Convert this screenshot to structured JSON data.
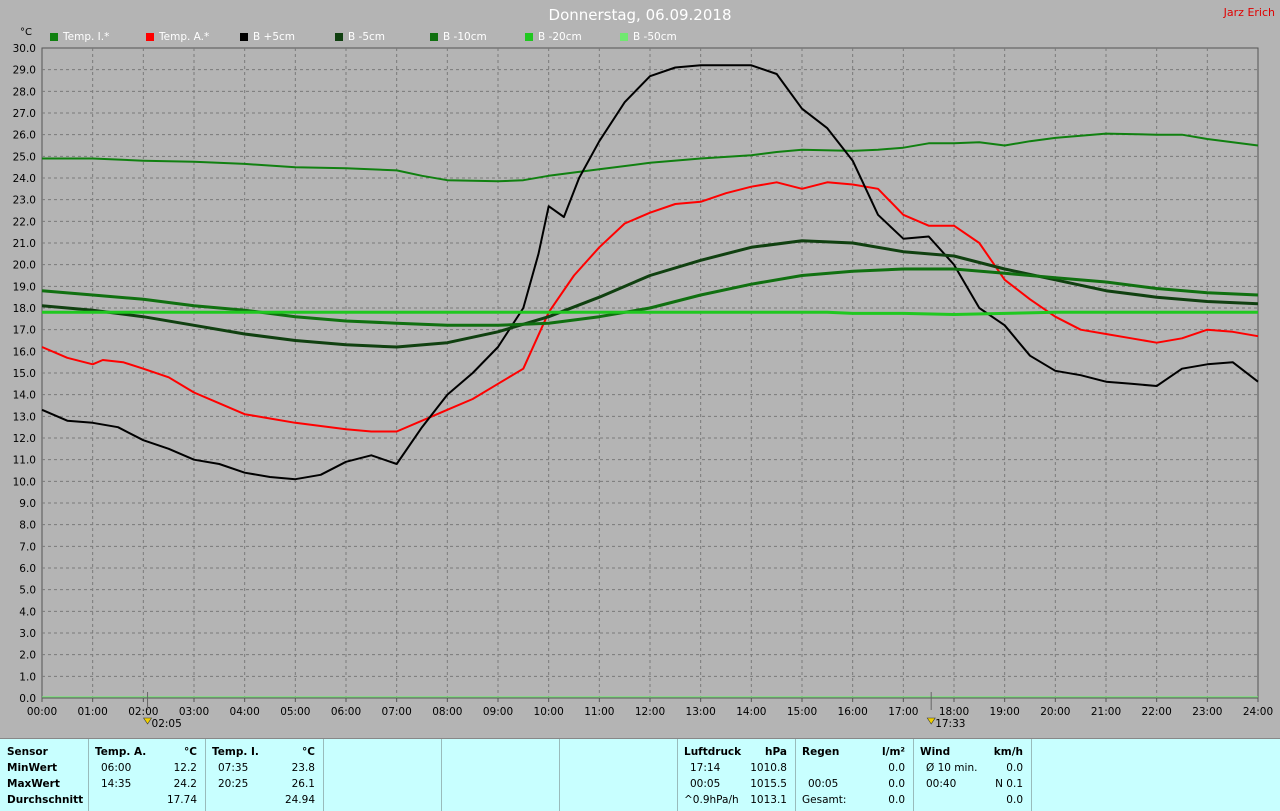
{
  "title": "Donnerstag, 06.09.2018",
  "author": "Jarz Erich",
  "unit": "°C",
  "colors": {
    "background": "#b4b4b4",
    "stats_bg": "#c8ffff",
    "temp_i": "#108010",
    "temp_a": "#ff0000",
    "b_plus5": "#000000",
    "b_minus5": "#104010",
    "b_minus10": "#107010",
    "b_minus20": "#20c820",
    "b_minus50": "#70e870"
  },
  "legend": [
    "Temp. I.*",
    "Temp. A.*",
    "B +5cm",
    "B -5cm",
    "B -10cm",
    "B -20cm",
    "B -50cm"
  ],
  "markers": [
    {
      "time": 2.083,
      "label": "02:05"
    },
    {
      "time": 17.55,
      "label": "17:33"
    }
  ],
  "chart_data": {
    "type": "line",
    "xlim": [
      0,
      24
    ],
    "ylim": [
      0,
      30
    ],
    "grid": true,
    "x_ticks": [
      "00:00",
      "01:00",
      "02:00",
      "03:00",
      "04:00",
      "05:00",
      "06:00",
      "07:00",
      "08:00",
      "09:00",
      "10:00",
      "11:00",
      "12:00",
      "13:00",
      "14:00",
      "15:00",
      "16:00",
      "17:00",
      "18:00",
      "19:00",
      "20:00",
      "21:00",
      "22:00",
      "23:00",
      "24:00"
    ],
    "y_ticks": [
      "0.0",
      "1.0",
      "2.0",
      "3.0",
      "4.0",
      "5.0",
      "6.0",
      "7.0",
      "8.0",
      "9.0",
      "10.0",
      "11.0",
      "12.0",
      "13.0",
      "14.0",
      "15.0",
      "16.0",
      "17.0",
      "18.0",
      "19.0",
      "20.0",
      "21.0",
      "22.0",
      "23.0",
      "24.0",
      "25.0",
      "26.0",
      "27.0",
      "28.0",
      "29.0",
      "30.0"
    ],
    "series": [
      {
        "name": "Temp. I.*",
        "width": 2,
        "points": [
          [
            0,
            24.9
          ],
          [
            1,
            24.9
          ],
          [
            2,
            24.8
          ],
          [
            3,
            24.75
          ],
          [
            4,
            24.65
          ],
          [
            5,
            24.5
          ],
          [
            6,
            24.45
          ],
          [
            7,
            24.35
          ],
          [
            7.5,
            24.1
          ],
          [
            8,
            23.9
          ],
          [
            9,
            23.85
          ],
          [
            9.5,
            23.9
          ],
          [
            10,
            24.1
          ],
          [
            11,
            24.4
          ],
          [
            12,
            24.7
          ],
          [
            13,
            24.9
          ],
          [
            14,
            25.05
          ],
          [
            14.5,
            25.2
          ],
          [
            15,
            25.3
          ],
          [
            16,
            25.25
          ],
          [
            16.5,
            25.3
          ],
          [
            17,
            25.4
          ],
          [
            17.5,
            25.6
          ],
          [
            18,
            25.6
          ],
          [
            18.5,
            25.65
          ],
          [
            19,
            25.5
          ],
          [
            19.5,
            25.7
          ],
          [
            20,
            25.85
          ],
          [
            21,
            26.05
          ],
          [
            22,
            26.0
          ],
          [
            22.5,
            26.0
          ],
          [
            23,
            25.8
          ],
          [
            24,
            25.5
          ]
        ]
      },
      {
        "name": "Temp. A.*",
        "width": 2,
        "points": [
          [
            0,
            16.2
          ],
          [
            0.5,
            15.7
          ],
          [
            1,
            15.4
          ],
          [
            1.2,
            15.6
          ],
          [
            1.6,
            15.5
          ],
          [
            2,
            15.2
          ],
          [
            2.5,
            14.8
          ],
          [
            3,
            14.1
          ],
          [
            3.5,
            13.6
          ],
          [
            4,
            13.1
          ],
          [
            4.5,
            12.9
          ],
          [
            5,
            12.7
          ],
          [
            6,
            12.4
          ],
          [
            6.5,
            12.3
          ],
          [
            7,
            12.3
          ],
          [
            7.5,
            12.8
          ],
          [
            8,
            13.3
          ],
          [
            8.5,
            13.8
          ],
          [
            9,
            14.5
          ],
          [
            9.5,
            15.2
          ],
          [
            10,
            17.8
          ],
          [
            10.5,
            19.5
          ],
          [
            11,
            20.8
          ],
          [
            11.5,
            21.9
          ],
          [
            12,
            22.4
          ],
          [
            12.5,
            22.8
          ],
          [
            13,
            22.9
          ],
          [
            13.5,
            23.3
          ],
          [
            14,
            23.6
          ],
          [
            14.5,
            23.8
          ],
          [
            15,
            23.5
          ],
          [
            15.5,
            23.8
          ],
          [
            16,
            23.7
          ],
          [
            16.5,
            23.5
          ],
          [
            17,
            22.3
          ],
          [
            17.5,
            21.8
          ],
          [
            18,
            21.8
          ],
          [
            18.5,
            21.0
          ],
          [
            19,
            19.3
          ],
          [
            19.5,
            18.4
          ],
          [
            20,
            17.6
          ],
          [
            20.5,
            17.0
          ],
          [
            21,
            16.8
          ],
          [
            21.5,
            16.6
          ],
          [
            22,
            16.4
          ],
          [
            22.5,
            16.6
          ],
          [
            23,
            17.0
          ],
          [
            23.5,
            16.9
          ],
          [
            24,
            16.7
          ]
        ]
      },
      {
        "name": "B +5cm",
        "width": 2,
        "points": [
          [
            0,
            13.3
          ],
          [
            0.5,
            12.8
          ],
          [
            1,
            12.7
          ],
          [
            1.5,
            12.5
          ],
          [
            2,
            11.9
          ],
          [
            2.5,
            11.5
          ],
          [
            3,
            11.0
          ],
          [
            3.5,
            10.8
          ],
          [
            4,
            10.4
          ],
          [
            4.5,
            10.2
          ],
          [
            5,
            10.1
          ],
          [
            5.5,
            10.3
          ],
          [
            6,
            10.9
          ],
          [
            6.5,
            11.2
          ],
          [
            7,
            10.8
          ],
          [
            7.5,
            12.5
          ],
          [
            8,
            14.0
          ],
          [
            8.5,
            15.0
          ],
          [
            9,
            16.2
          ],
          [
            9.5,
            18.0
          ],
          [
            9.8,
            20.5
          ],
          [
            10,
            22.7
          ],
          [
            10.3,
            22.2
          ],
          [
            10.6,
            24.0
          ],
          [
            11,
            25.7
          ],
          [
            11.5,
            27.5
          ],
          [
            12,
            28.7
          ],
          [
            12.5,
            29.1
          ],
          [
            13,
            29.2
          ],
          [
            13.5,
            29.2
          ],
          [
            14,
            29.2
          ],
          [
            14.5,
            28.8
          ],
          [
            15,
            27.2
          ],
          [
            15.5,
            26.3
          ],
          [
            16,
            24.8
          ],
          [
            16.5,
            22.3
          ],
          [
            17,
            21.2
          ],
          [
            17.5,
            21.3
          ],
          [
            18,
            20.0
          ],
          [
            18.5,
            18.0
          ],
          [
            19,
            17.2
          ],
          [
            19.5,
            15.8
          ],
          [
            20,
            15.1
          ],
          [
            20.5,
            14.9
          ],
          [
            21,
            14.6
          ],
          [
            21.5,
            14.5
          ],
          [
            22,
            14.4
          ],
          [
            22.5,
            15.2
          ],
          [
            23,
            15.4
          ],
          [
            23.5,
            15.5
          ],
          [
            24,
            14.6
          ]
        ]
      },
      {
        "name": "B -5cm",
        "width": 3,
        "points": [
          [
            0,
            18.1
          ],
          [
            1,
            17.9
          ],
          [
            2,
            17.6
          ],
          [
            3,
            17.2
          ],
          [
            4,
            16.8
          ],
          [
            5,
            16.5
          ],
          [
            6,
            16.3
          ],
          [
            7,
            16.2
          ],
          [
            8,
            16.4
          ],
          [
            9,
            16.9
          ],
          [
            10,
            17.6
          ],
          [
            11,
            18.5
          ],
          [
            12,
            19.5
          ],
          [
            13,
            20.2
          ],
          [
            14,
            20.8
          ],
          [
            15,
            21.1
          ],
          [
            16,
            21.0
          ],
          [
            17,
            20.6
          ],
          [
            18,
            20.4
          ],
          [
            19,
            19.8
          ],
          [
            20,
            19.3
          ],
          [
            21,
            18.8
          ],
          [
            22,
            18.5
          ],
          [
            23,
            18.3
          ],
          [
            24,
            18.2
          ]
        ]
      },
      {
        "name": "B -10cm",
        "width": 3,
        "points": [
          [
            0,
            18.8
          ],
          [
            1,
            18.6
          ],
          [
            2,
            18.4
          ],
          [
            3,
            18.1
          ],
          [
            4,
            17.9
          ],
          [
            5,
            17.6
          ],
          [
            6,
            17.4
          ],
          [
            7,
            17.3
          ],
          [
            8,
            17.2
          ],
          [
            9,
            17.2
          ],
          [
            10,
            17.3
          ],
          [
            11,
            17.6
          ],
          [
            12,
            18.0
          ],
          [
            13,
            18.6
          ],
          [
            14,
            19.1
          ],
          [
            15,
            19.5
          ],
          [
            16,
            19.7
          ],
          [
            17,
            19.8
          ],
          [
            18,
            19.8
          ],
          [
            19,
            19.6
          ],
          [
            20,
            19.4
          ],
          [
            21,
            19.2
          ],
          [
            22,
            18.9
          ],
          [
            23,
            18.7
          ],
          [
            24,
            18.6
          ]
        ]
      },
      {
        "name": "B -20cm",
        "width": 3,
        "points": [
          [
            0,
            17.8
          ],
          [
            3,
            17.8
          ],
          [
            6,
            17.8
          ],
          [
            9,
            17.8
          ],
          [
            12,
            17.8
          ],
          [
            14,
            17.8
          ],
          [
            15,
            17.8
          ],
          [
            15.5,
            17.8
          ],
          [
            16,
            17.75
          ],
          [
            17,
            17.75
          ],
          [
            18,
            17.7
          ],
          [
            19,
            17.75
          ],
          [
            20,
            17.8
          ],
          [
            24,
            17.8
          ]
        ]
      },
      {
        "name": "B -50cm",
        "width": 1,
        "points": [
          [
            0,
            0.05
          ],
          [
            24,
            0.05
          ]
        ]
      }
    ]
  },
  "stats": {
    "sensor": {
      "header": "Sensor",
      "rows": [
        "MinWert",
        "MaxWert",
        "Durchschnitt"
      ]
    },
    "temp_a": {
      "name": "Temp. A.",
      "unit": "°C",
      "min_time": "06:00",
      "min_val": "12.2",
      "max_time": "14:35",
      "max_val": "24.2",
      "avg": "17.74"
    },
    "temp_i": {
      "name": "Temp. I.",
      "unit": "°C",
      "min_time": "07:35",
      "min_val": "23.8",
      "max_time": "20:25",
      "max_val": "26.1",
      "avg": "24.94"
    },
    "luftdruck": {
      "name": "Luftdruck",
      "unit": "hPa",
      "r1a": "17:14",
      "r1b": "1010.8",
      "r2a": "00:05",
      "r2b": "1015.5",
      "r3a": "^0.9hPa/h",
      "r3b": "1013.1"
    },
    "regen": {
      "name": "Regen",
      "unit": "l/m²",
      "r1a": "",
      "r1b": "0.0",
      "r2a": "00:05",
      "r2b": "0.0",
      "r3a": "Gesamt:",
      "r3b": "0.0"
    },
    "wind": {
      "name": "Wind",
      "unit": "km/h",
      "r1a": "Ø 10 min.",
      "r1b": "0.0",
      "r2a": "00:40",
      "r2b": "N 0.1",
      "r3a": "",
      "r3b": "0.0"
    }
  }
}
